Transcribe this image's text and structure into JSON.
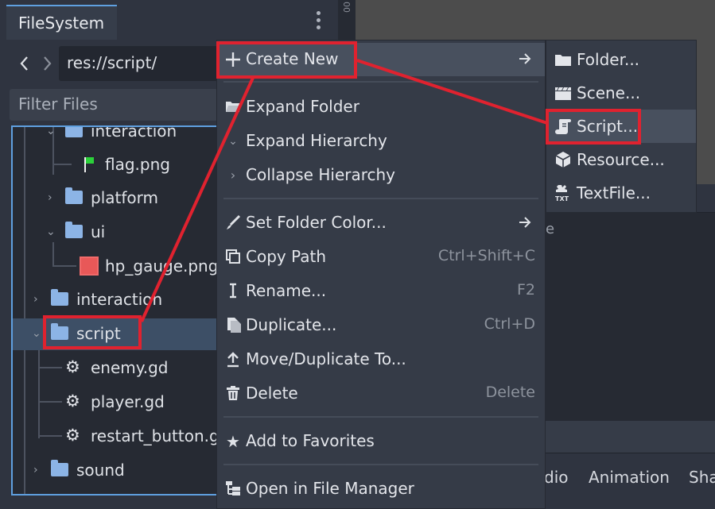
{
  "dock": {
    "tab_label": "FileSystem",
    "path": "res://script/",
    "filter_placeholder": "Filter Files"
  },
  "tree": {
    "items": [
      {
        "label": "interaction",
        "type": "folder"
      },
      {
        "label": "flag.png",
        "type": "image"
      },
      {
        "label": "platform",
        "type": "folder"
      },
      {
        "label": "ui",
        "type": "folder"
      },
      {
        "label": "hp_gauge.png",
        "type": "image"
      },
      {
        "label": "interaction",
        "type": "folder"
      },
      {
        "label": "script",
        "type": "folder",
        "selected": true
      },
      {
        "label": "enemy.gd",
        "type": "script"
      },
      {
        "label": "player.gd",
        "type": "script"
      },
      {
        "label": "restart_button.gd",
        "type": "script"
      },
      {
        "label": "sound",
        "type": "folder"
      }
    ]
  },
  "context_menu": {
    "items": [
      {
        "label": "Create New",
        "icon": "plus-icon",
        "submenu": true
      },
      {
        "label": "Expand Folder",
        "icon": "folder-open-icon"
      },
      {
        "label": "Expand Hierarchy",
        "icon": "chevron-down-icon"
      },
      {
        "label": "Collapse Hierarchy",
        "icon": "chevron-right-icon"
      },
      {
        "label": "Set Folder Color...",
        "icon": "brush-icon",
        "submenu": true
      },
      {
        "label": "Copy Path",
        "icon": "copy-icon",
        "shortcut": "Ctrl+Shift+C"
      },
      {
        "label": "Rename...",
        "icon": "text-cursor-icon",
        "shortcut": "F2"
      },
      {
        "label": "Duplicate...",
        "icon": "duplicate-icon",
        "shortcut": "Ctrl+D"
      },
      {
        "label": "Move/Duplicate To...",
        "icon": "move-up-icon"
      },
      {
        "label": "Delete",
        "icon": "trash-icon",
        "shortcut": "Delete"
      },
      {
        "label": "Add to Favorites",
        "icon": "star-icon"
      },
      {
        "label": "Open in File Manager",
        "icon": "file-tree-icon"
      }
    ]
  },
  "submenu": {
    "items": [
      {
        "label": "Folder...",
        "icon": "folder-icon"
      },
      {
        "label": "Scene...",
        "icon": "clapperboard-icon"
      },
      {
        "label": "Script...",
        "icon": "script-scroll-icon"
      },
      {
        "label": "Resource...",
        "icon": "cube-icon"
      },
      {
        "label": "TextFile...",
        "icon": "txt-file-icon"
      }
    ]
  },
  "bottom_tabs": [
    "dio",
    "Animation",
    "Sha"
  ],
  "partial_text": "e",
  "editor_strip_text": "00",
  "colors": {
    "highlight": "#e0222f",
    "accent": "#5fa0e0",
    "folder": "#8cb4e6"
  }
}
